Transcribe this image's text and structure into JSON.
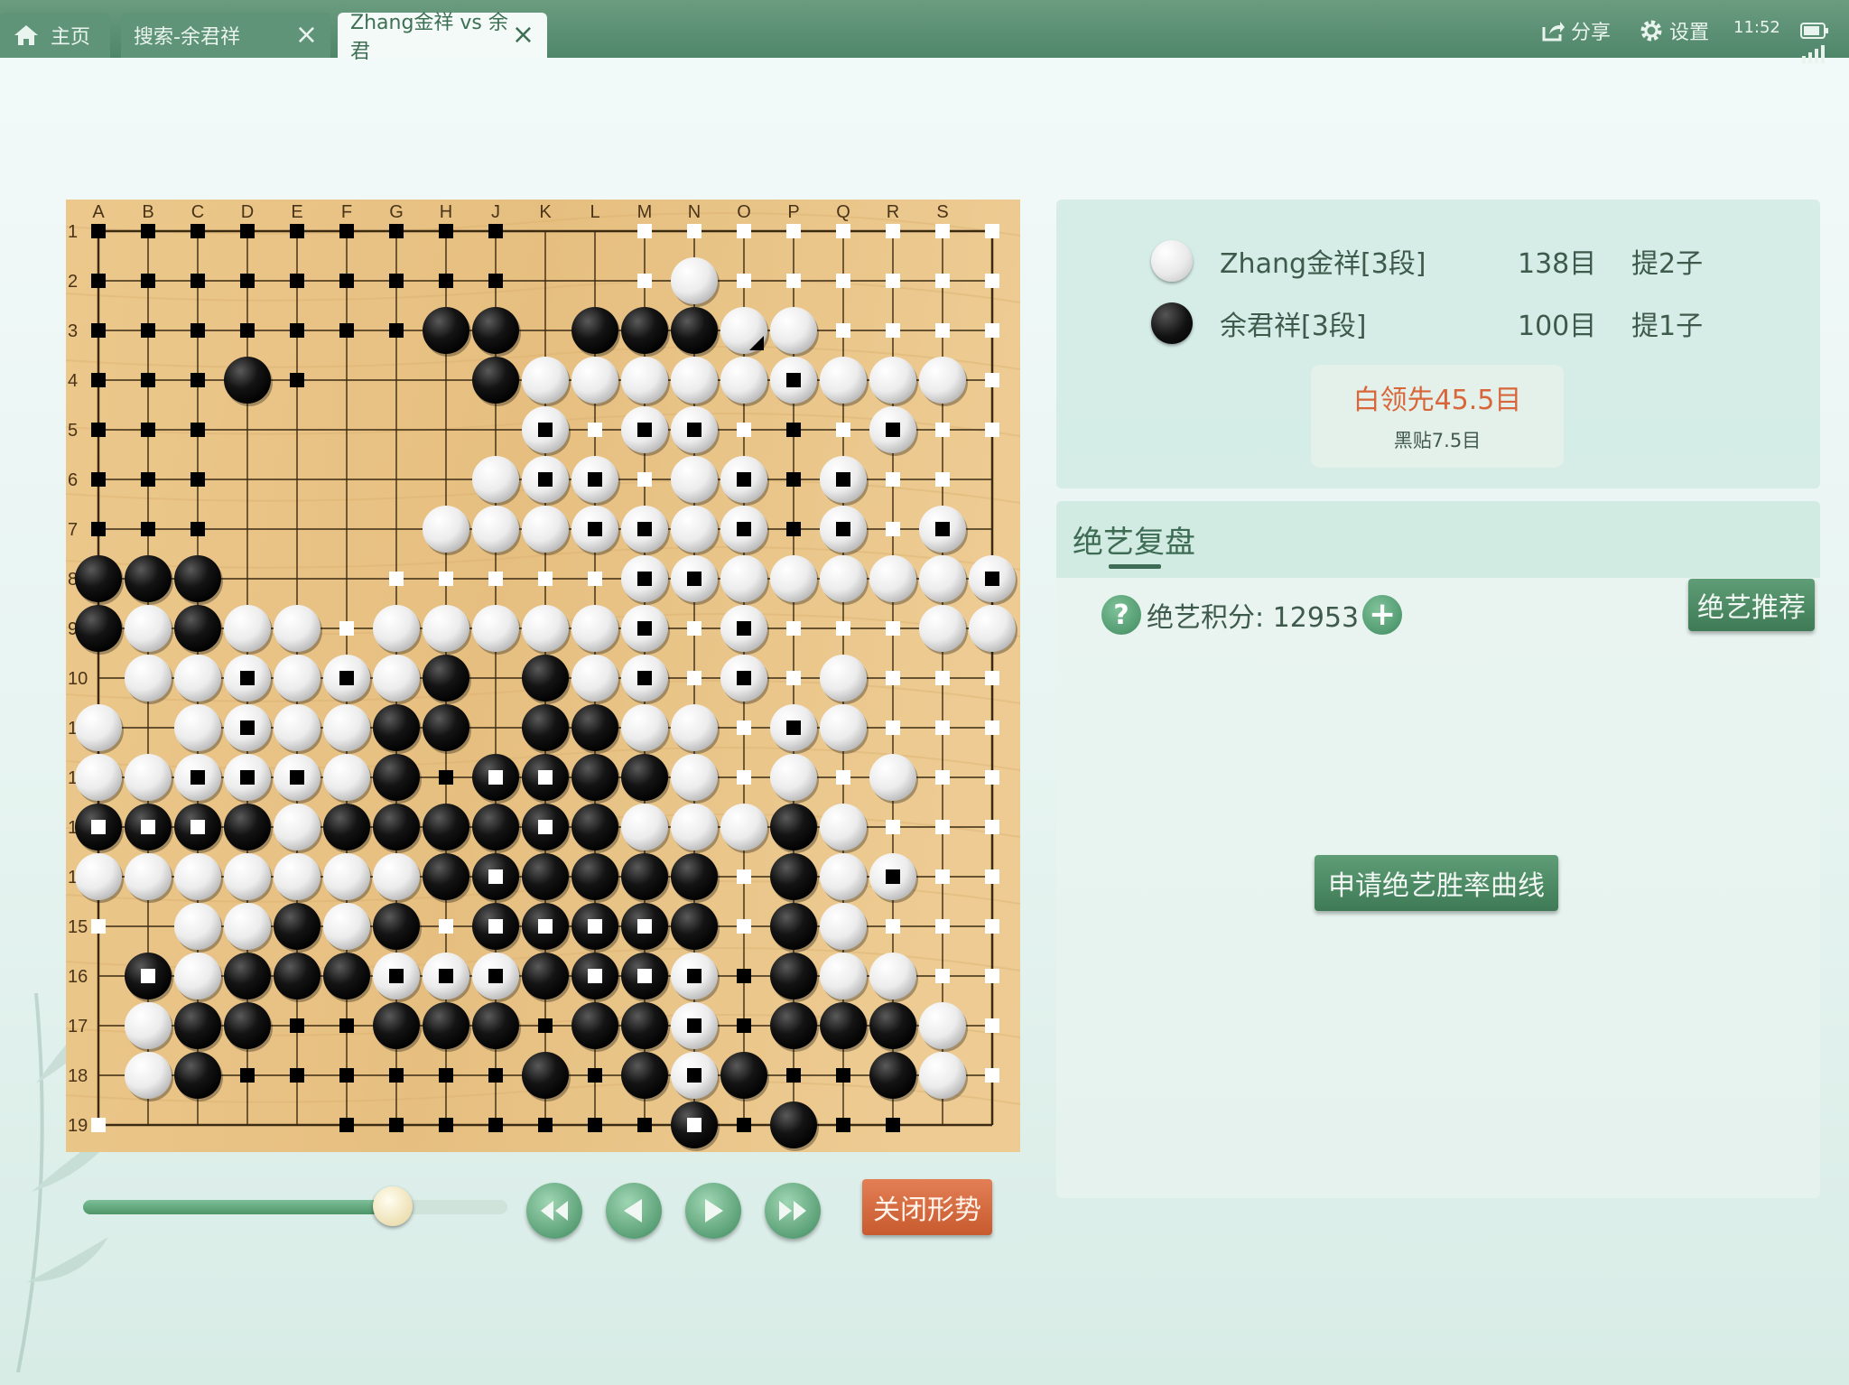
{
  "tabs": [
    {
      "label": "主页",
      "icon": "home-icon"
    },
    {
      "label": "搜索-余君祥",
      "close": "×"
    },
    {
      "label": "Zhang金祥 vs 余君",
      "close": "×",
      "active": true
    }
  ],
  "toolbar": {
    "share_label": "分享",
    "settings_label": "设置",
    "time": "11:52"
  },
  "board": {
    "size": 19,
    "columns": [
      "A",
      "B",
      "C",
      "D",
      "E",
      "F",
      "G",
      "H",
      "J",
      "K",
      "L",
      "M",
      "N",
      "O",
      "P",
      "Q",
      "R",
      "S"
    ],
    "row_labels": [
      "1",
      "2",
      "3",
      "4",
      "5",
      "6",
      "7",
      "8",
      "9",
      "10",
      "11",
      "12",
      "13",
      "14",
      "15",
      "16",
      "17",
      "18",
      "19"
    ],
    "legend": "rows top→bottom; . empty, X black, O white, x black-area marker, o white-area marker, D dead black stone, W dead white stone",
    "rows": [
      "xxxxxxxxx..oooooooo",
      "xxxxxxxxx..oOoooooo",
      "xxxxxxxXX.XXXOOoooo",
      "xxxXx...XOOOOOWOOOo",
      "xxx......WoWWoxoWoo",
      "xxx.....OWWoOWxWoo.",
      "xxx....OOOWWOWxWoW.",
      "XXX...oooooWWOOOOOWo",
      "XOXOOoOOOOOWoWoooOO",
      ".OOWOWOX.XOWoWoOooo",
      "O.OWOOXX.XXOOoWOooo",
      "OOWWWOXxDDXXOoOoOoo",
      "DDDXOXXXXDXOOOXOooo",
      "OOOOOOOXDXXXXoXOWoo",
      "o.OOXOXoDDDDXoXOooo",
      ".DOXXXWWWXDDWxXOOoo",
      ".OXXxxXXXxXXWxXXXOo",
      ".OXxxxxxxXxXWXxxXOo",
      "o....xxxxxxxDxXxx..o"
    ],
    "last_move": "O3"
  },
  "players": [
    {
      "color": "white",
      "name": "Zhang金祥[3段]",
      "score": "138目",
      "captures": "提2子"
    },
    {
      "color": "black",
      "name": "余君祥[3段]",
      "score": "100目",
      "captures": "提1子"
    }
  ],
  "lead": {
    "main": "白领先45.5目",
    "komi": "黑贴7.5目"
  },
  "analysis": {
    "title": "绝艺复盘",
    "score_label": "绝艺积分: 12953",
    "recommend_button": "绝艺推荐",
    "curve_button": "申请绝艺胜率曲线"
  },
  "controls": {
    "progress_fraction": 0.73,
    "close_trend_label": "关闭形势"
  },
  "colors": {
    "tab_bar": "#5f9479",
    "accent_green": "#3d7a55",
    "lead_text": "#d9663a",
    "board_wood": "#e9c489"
  }
}
